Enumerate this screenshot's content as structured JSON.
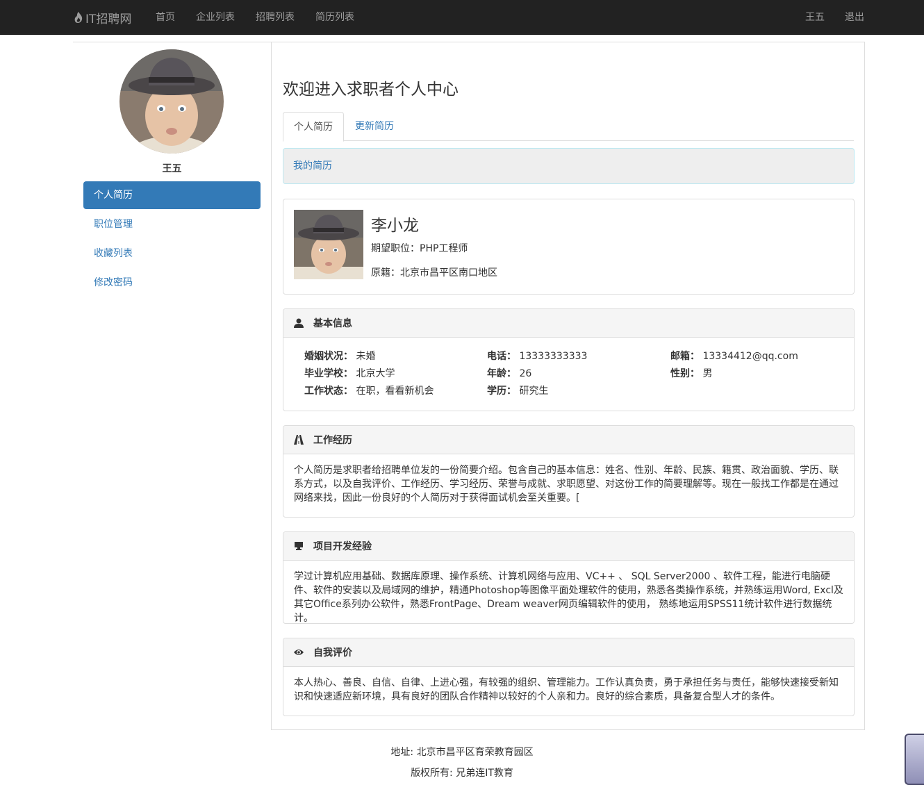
{
  "navbar": {
    "brand": "IT招聘网",
    "links": [
      "首页",
      "企业列表",
      "招聘列表",
      "简历列表"
    ],
    "user": "王五",
    "logout": "退出"
  },
  "sidebar": {
    "username": "王五",
    "items": [
      {
        "label": "个人简历",
        "active": true
      },
      {
        "label": "职位管理",
        "active": false
      },
      {
        "label": "收藏列表",
        "active": false
      },
      {
        "label": "修改密码",
        "active": false
      }
    ]
  },
  "main": {
    "welcome": "欢迎进入求职者个人中心",
    "tabs": [
      "个人简历",
      "更新简历"
    ],
    "my_resume": "我的简历",
    "profile": {
      "name": "李小龙",
      "position_label": "期望职位：",
      "position": "PHP工程师",
      "origin_label": "原籍：",
      "origin": "北京市昌平区南口地区"
    },
    "basic_info": {
      "title": "基本信息",
      "fields": {
        "marital_k": "婚姻状况：",
        "marital_v": "未婚",
        "phone_k": "电话：",
        "phone_v": "13333333333",
        "email_k": "邮箱：",
        "email_v": "13334412@qq.com",
        "school_k": "毕业学校：",
        "school_v": "北京大学",
        "age_k": "年龄：",
        "age_v": "26",
        "gender_k": "性别：",
        "gender_v": "男",
        "work_k": "工作状态：",
        "work_v": "在职，看看新机会",
        "edu_k": "学历：",
        "edu_v": "研究生"
      }
    },
    "work_experience": {
      "title": "工作经历",
      "text": "个人简历是求职者给招聘单位发的一份简要介绍。包含自己的基本信息：姓名、性别、年龄、民族、籍贯、政治面貌、学历、联系方式，以及自我评价、工作经历、学习经历、荣誉与成就、求职愿望、对这份工作的简要理解等。现在一般找工作都是在通过网络来找，因此一份良好的个人简历对于获得面试机会至关重要。["
    },
    "project_experience": {
      "title": "项目开发经验",
      "text": "学过计算机应用基础、数据库原理、操作系统、计算机网络与应用、VC++ 、 SQL Server2000 、软件工程，能进行电脑硬件、软件的安装以及局域网的维护，精通Photoshop等图像平面处理软件的使用，熟悉各类操作系统，并熟练运用Word, Excl及其它Office系列办公软件，熟悉FrontPage、Dream weaver网页编辑软件的使用， 熟练地运用SPSS11统计软件进行数据统计。"
    },
    "self_evaluation": {
      "title": "自我评价",
      "text": "本人热心、善良、自信、自律、上进心强，有较强的组织、管理能力。工作认真负责，勇于承担任务与责任，能够快速接受新知识和快速适应新环境，具有良好的团队合作精神以较好的个人亲和力。良好的综合素质，具备复合型人才的条件。"
    }
  },
  "footer": {
    "address": "地址: 北京市昌平区育荣教育园区",
    "copyright": "版权所有: 兄弟连IT教育"
  },
  "colors": {
    "primary": "#337ab7",
    "navbar": "#222222",
    "panel_head": "#f5f5f5"
  }
}
